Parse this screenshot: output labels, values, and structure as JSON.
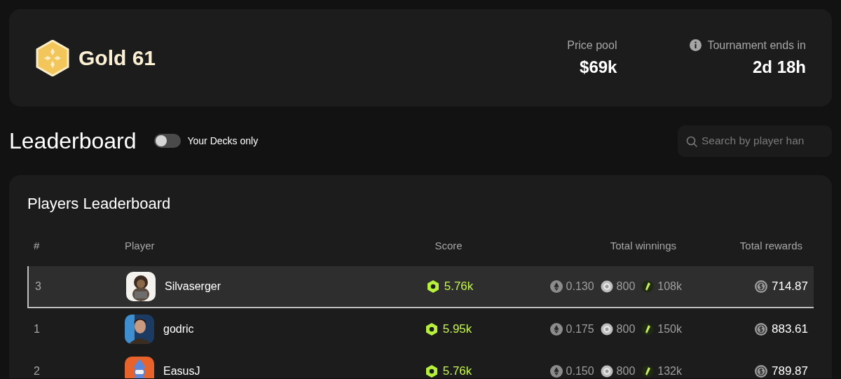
{
  "tournament": {
    "name": "Gold 61",
    "stats": [
      {
        "label": "Price pool",
        "value": "$69k",
        "info": false
      },
      {
        "label": "Tournament ends in",
        "value": "2d 18h",
        "info": true
      }
    ]
  },
  "leaderboard": {
    "title": "Leaderboard",
    "toggle": {
      "label": "Your Decks only",
      "on": false
    },
    "search": {
      "placeholder": "Search by player han"
    }
  },
  "table": {
    "title": "Players Leaderboard",
    "columns": [
      "#",
      "Player",
      "Score",
      "Total winnings",
      "Total rewards"
    ],
    "rows": [
      {
        "rank": "3",
        "player": "Silvaserger",
        "score": "5.76k",
        "winnings": [
          "0.130",
          "800",
          "108k"
        ],
        "rewards": "714.87",
        "selected": true
      },
      {
        "rank": "1",
        "player": "godric",
        "score": "5.95k",
        "winnings": [
          "0.175",
          "800",
          "150k"
        ],
        "rewards": "883.61",
        "selected": false
      },
      {
        "rank": "2",
        "player": "EasusJ",
        "score": "5.76k",
        "winnings": [
          "0.150",
          "800",
          "132k"
        ],
        "rewards": "789.87",
        "selected": false
      }
    ]
  }
}
